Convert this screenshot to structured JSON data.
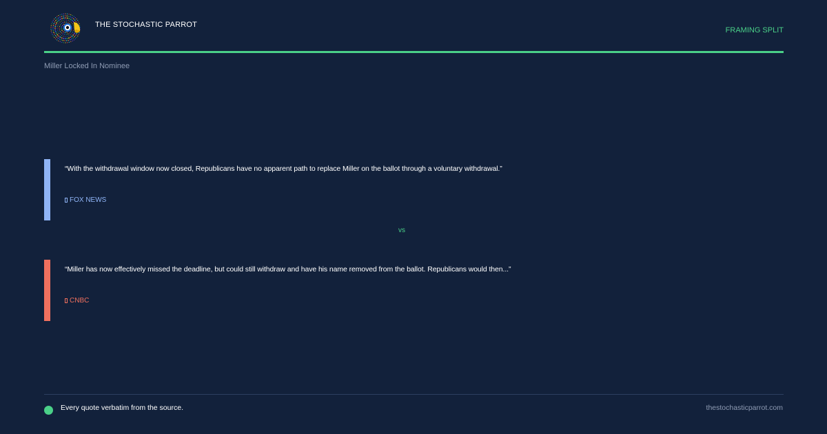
{
  "header": {
    "brand": "THE STOCHASTIC PARROT",
    "tag": "FRAMING SPLIT"
  },
  "topic": "Miller Locked In Nominee",
  "quotes": [
    {
      "text": "“With the withdrawal window now closed, Republicans have no apparent path to replace Miller on the ballot through a voluntary withdrawal.”",
      "source": "FOX NEWS",
      "color": "#8fb4f6"
    },
    {
      "text": "“Miller has now effectively missed the deadline, but could still withdraw and have his name removed from the ballot. Republicans would then...”",
      "source": "CNBC",
      "color": "#f0705e"
    }
  ],
  "separator": "vs",
  "footer": {
    "note": "Every quote verbatim from the source.",
    "url": "thestochasticparrot.com"
  },
  "colors": {
    "background": "#12213b",
    "accent": "#4ad088"
  },
  "icons": {
    "logo": "parrot-logo-icon",
    "source_marker": "source-marker-icon",
    "status": "status-dot-icon"
  }
}
